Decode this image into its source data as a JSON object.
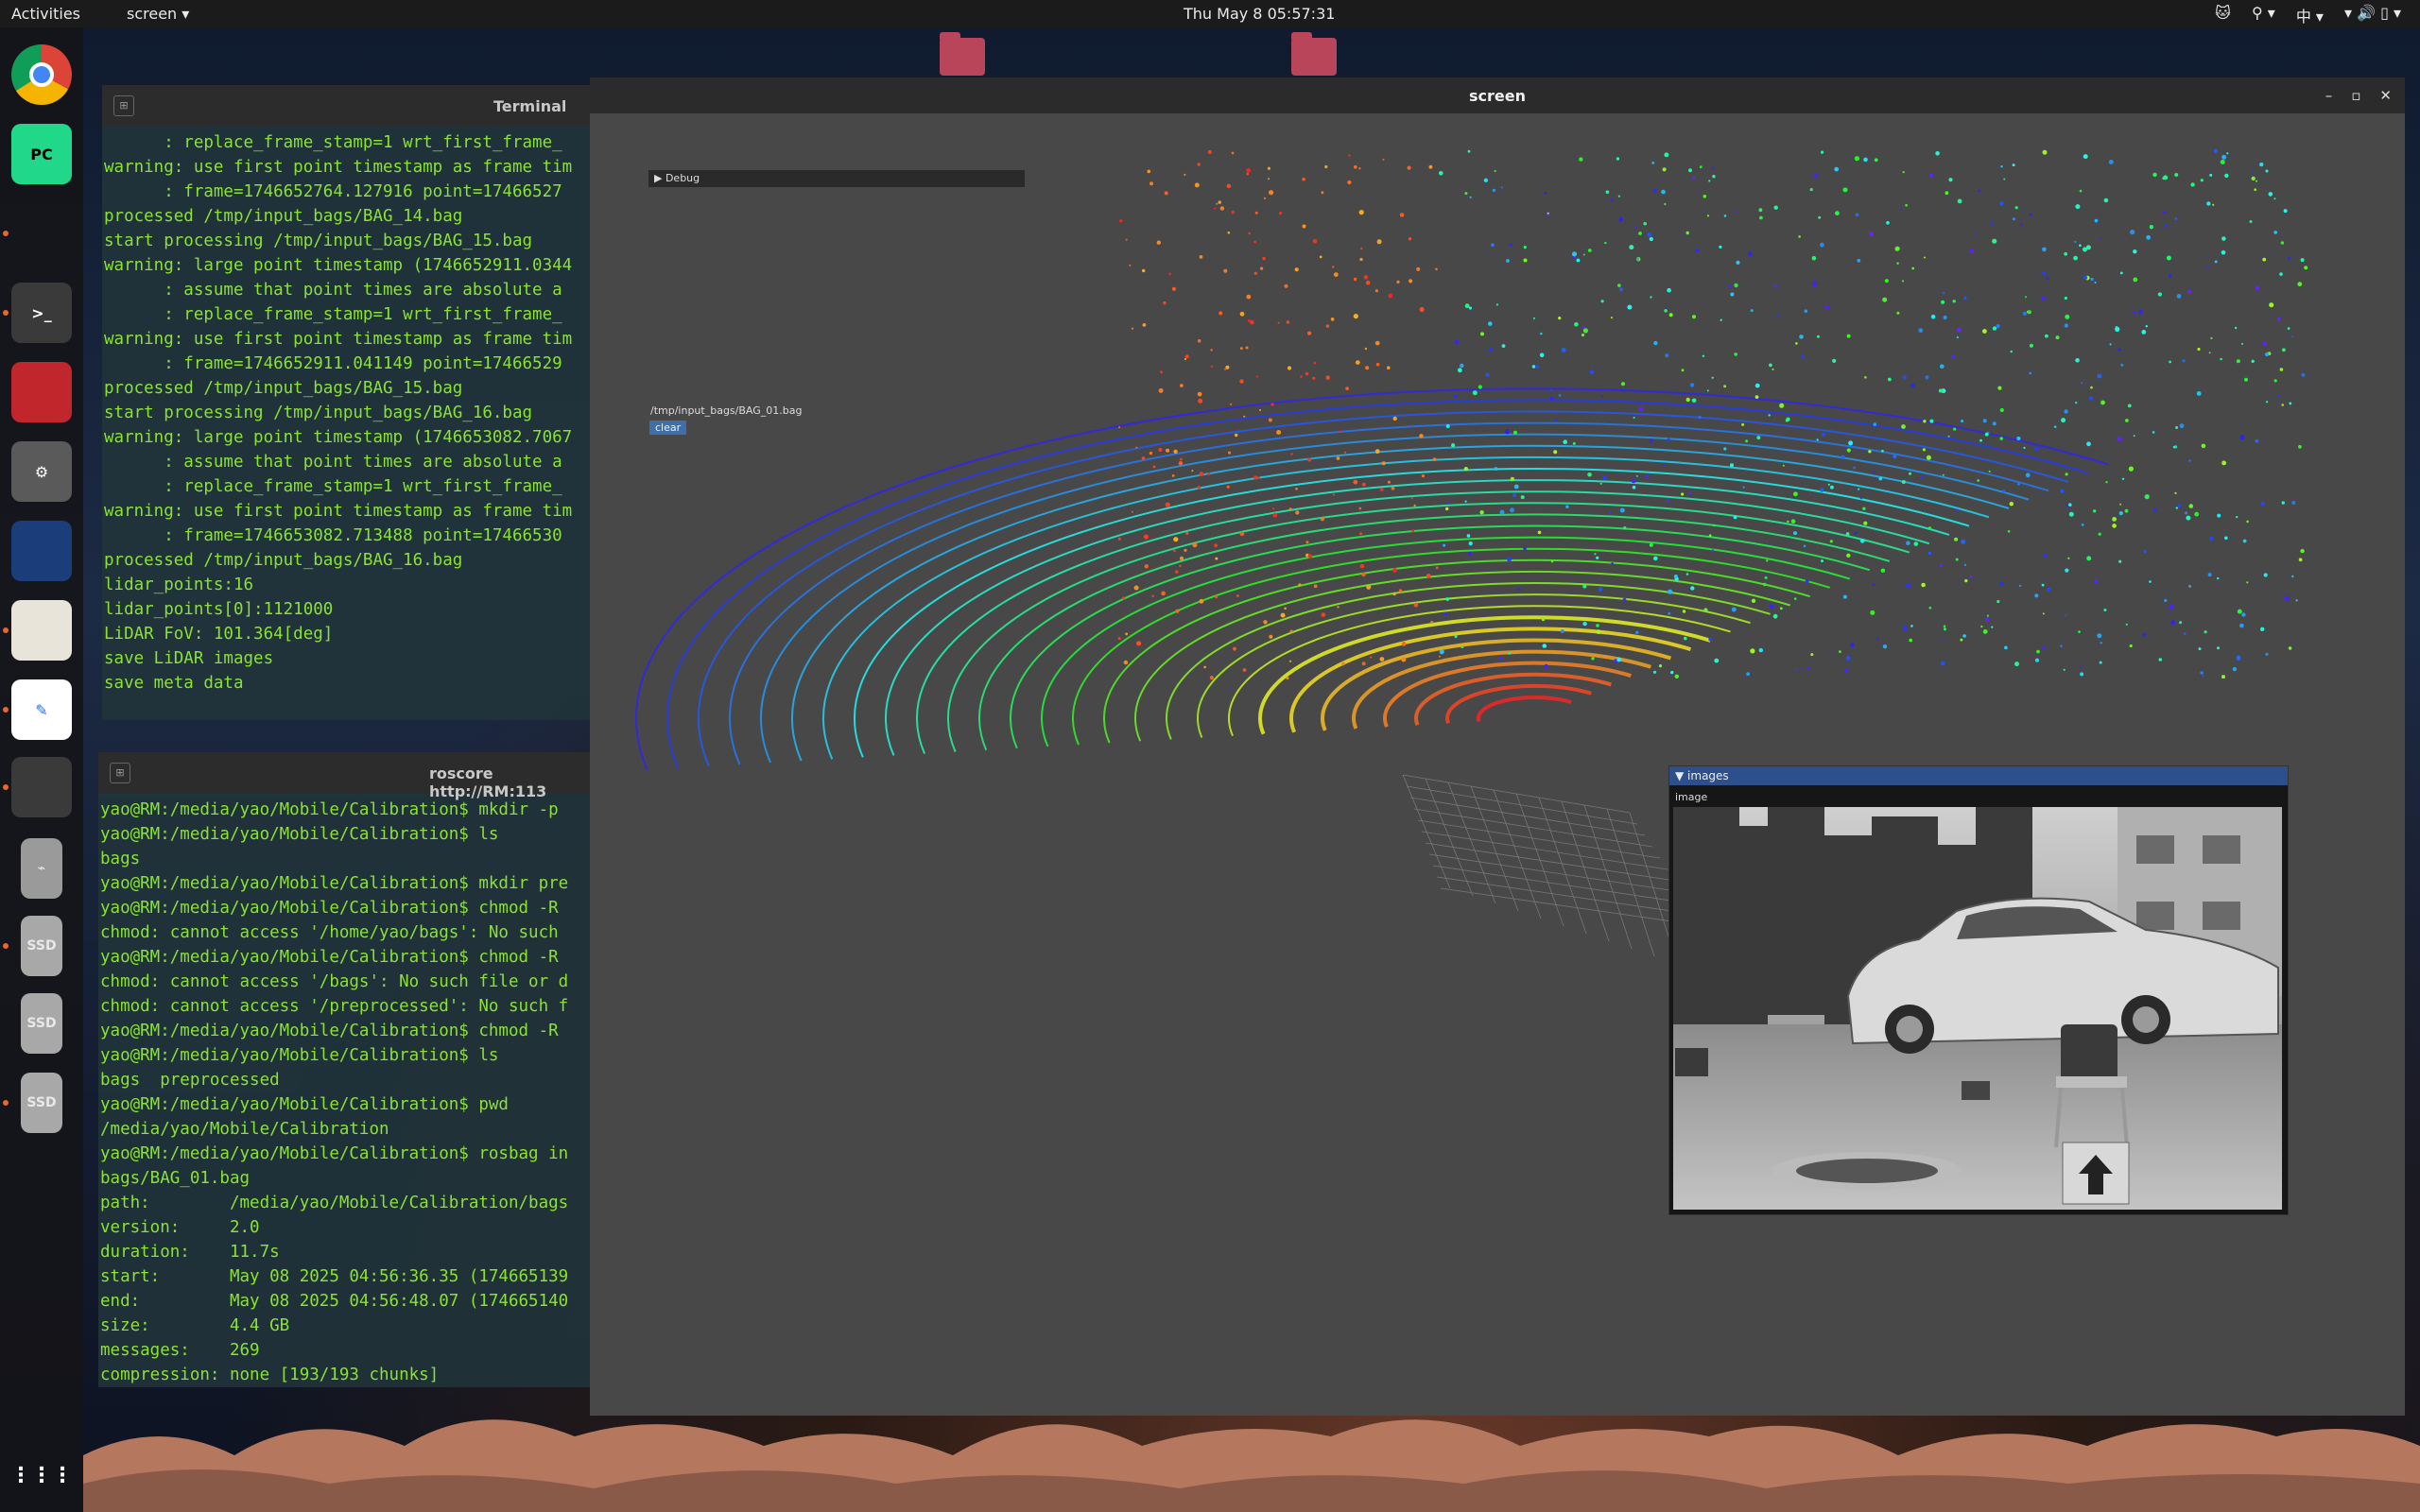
{
  "topbar": {
    "activities": "Activities",
    "app_menu": "screen ▾",
    "clock": "Thu May 8  05:57:31",
    "tray": [
      "🐱",
      "⚲ ▾",
      "中 ▾",
      "▾ 🔊 ▯ ▾"
    ]
  },
  "dock": {
    "items": [
      {
        "name": "chrome-icon",
        "label": "",
        "color": "#ffffff"
      },
      {
        "name": "pycharm-icon",
        "label": "PC",
        "color": "#21d789"
      },
      {
        "name": "vscode-icon",
        "label": "",
        "color": "#1e88e5"
      },
      {
        "name": "terminal-icon",
        "label": ">_",
        "color": "#3a3a3a"
      },
      {
        "name": "app-red-icon",
        "label": "",
        "color": "#c0262b"
      },
      {
        "name": "settings-icon",
        "label": "⚙",
        "color": "#5a5a5a"
      },
      {
        "name": "cat-icon",
        "label": "",
        "color": "#1b3d7a"
      },
      {
        "name": "files-icon",
        "label": "",
        "color": "#e8e4da"
      },
      {
        "name": "text-editor-icon",
        "label": "✎",
        "color": "#ffffff"
      },
      {
        "name": "screen-app-icon",
        "label": "",
        "color": "#3a3a3a"
      },
      {
        "name": "usb-drive-icon",
        "label": "⌁",
        "color": "#9a9a9a"
      },
      {
        "name": "ssd-drive-icon",
        "label": "SSD",
        "color": "#a8a8a8"
      },
      {
        "name": "ssd-drive-icon",
        "label": "SSD",
        "color": "#a8a8a8"
      },
      {
        "name": "ssd-drive-icon",
        "label": "SSD",
        "color": "#a8a8a8"
      }
    ],
    "show_apps": "⋮⋮⋮"
  },
  "terminal1": {
    "title": "Terminal",
    "lines": [
      "      : replace_frame_stamp=1 wrt_first_frame_",
      "warning: use first point timestamp as frame tim",
      "      : frame=1746652764.127916 point=17466527",
      "processed /tmp/input_bags/BAG_14.bag",
      "start processing /tmp/input_bags/BAG_15.bag",
      "warning: large point timestamp (1746652911.0344",
      "      : assume that point times are absolute a",
      "      : replace_frame_stamp=1 wrt_first_frame_",
      "warning: use first point timestamp as frame tim",
      "      : frame=1746652911.041149 point=17466529",
      "processed /tmp/input_bags/BAG_15.bag",
      "start processing /tmp/input_bags/BAG_16.bag",
      "warning: large point timestamp (1746653082.7067",
      "      : assume that point times are absolute a",
      "      : replace_frame_stamp=1 wrt_first_frame_",
      "warning: use first point timestamp as frame tim",
      "      : frame=1746653082.713488 point=17466530",
      "processed /tmp/input_bags/BAG_16.bag",
      "lidar_points:16",
      "lidar_points[0]:1121000",
      "LiDAR FoV: 101.364[deg]",
      "save LiDAR images",
      "save meta data"
    ]
  },
  "terminal2": {
    "title": "roscore http://RM:113",
    "lines": [
      "yao@RM:/media/yao/Mobile/Calibration$ mkdir -p",
      "yao@RM:/media/yao/Mobile/Calibration$ ls",
      "bags",
      "yao@RM:/media/yao/Mobile/Calibration$ mkdir pre",
      "yao@RM:/media/yao/Mobile/Calibration$ chmod -R",
      "chmod: cannot access '/home/yao/bags': No such",
      "yao@RM:/media/yao/Mobile/Calibration$ chmod -R",
      "chmod: cannot access '/bags': No such file or d",
      "chmod: cannot access '/preprocessed': No such f",
      "yao@RM:/media/yao/Mobile/Calibration$ chmod -R",
      "yao@RM:/media/yao/Mobile/Calibration$ ls",
      "bags  preprocessed",
      "yao@RM:/media/yao/Mobile/Calibration$ pwd",
      "/media/yao/Mobile/Calibration",
      "yao@RM:/media/yao/Mobile/Calibration$ rosbag in",
      "bags/BAG_01.bag",
      "path:        /media/yao/Mobile/Calibration/bags",
      "version:     2.0",
      "duration:    11.7s",
      "start:       May 08 2025 04:56:36.35 (174665139",
      "end:         May 08 2025 04:56:48.07 (174665140",
      "size:        4.4 GB",
      "messages:    269",
      "compression: none [193/193 chunks]"
    ]
  },
  "screen_window": {
    "title": "screen",
    "btn_min": "–",
    "btn_max": "▫",
    "btn_close": "✕",
    "debug_label": "▶ Debug",
    "bag_path": "/tmp/input_bags/BAG_01.bag",
    "clear_label": "clear",
    "images_header": "▼ images",
    "image_label": "image"
  },
  "colors": {
    "terminal_text": "#8ae234",
    "terminal_bg": "#21333a",
    "panel_header": "#2d4f8c",
    "clear_button": "#3e6fa8"
  }
}
